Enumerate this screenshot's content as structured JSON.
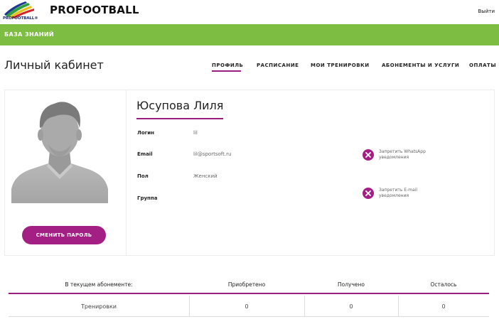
{
  "header": {
    "logo_text": "PROFOOTBALL®",
    "brand": "PROFOOTBALL",
    "logout_label": "Выйти"
  },
  "nav": {
    "knowledge_base": "БАЗА ЗНАНИЙ"
  },
  "page": {
    "title": "Личный кабинет"
  },
  "tabs": [
    {
      "label": "ПРОФИЛЬ",
      "active": true
    },
    {
      "label": "РАСПИСАНИЕ",
      "active": false
    },
    {
      "label": "МОИ ТРЕНИРОВКИ",
      "active": false
    },
    {
      "label": "АБОНЕМЕНТЫ И УСЛУГИ",
      "active": false
    },
    {
      "label": "ОПЛАТЫ",
      "active": false
    }
  ],
  "profile": {
    "name": "Юсупова Лиля",
    "fields": [
      {
        "label": "Логин",
        "value": "lil"
      },
      {
        "label": "Email",
        "value": "lil@sportsoft.ru"
      },
      {
        "label": "Пол",
        "value": "Женский"
      },
      {
        "label": "Группа",
        "value": ""
      }
    ],
    "change_password_label": "СМЕНИТЬ ПАРОЛЬ",
    "whatsapp_toggle_label": "Запретить WhatsApp уведомления",
    "email_toggle_label": "Запретить E-mail уведомления"
  },
  "subscription_table": {
    "headers": [
      "В текущем абонементе:",
      "Приобретено",
      "Получено",
      "Осталось"
    ],
    "rows": [
      {
        "name": "Тренировки",
        "purchased": "0",
        "received": "0",
        "remaining": "0"
      }
    ]
  },
  "colors": {
    "accent": "#a41f83",
    "green_bar": "#7cbd42"
  }
}
